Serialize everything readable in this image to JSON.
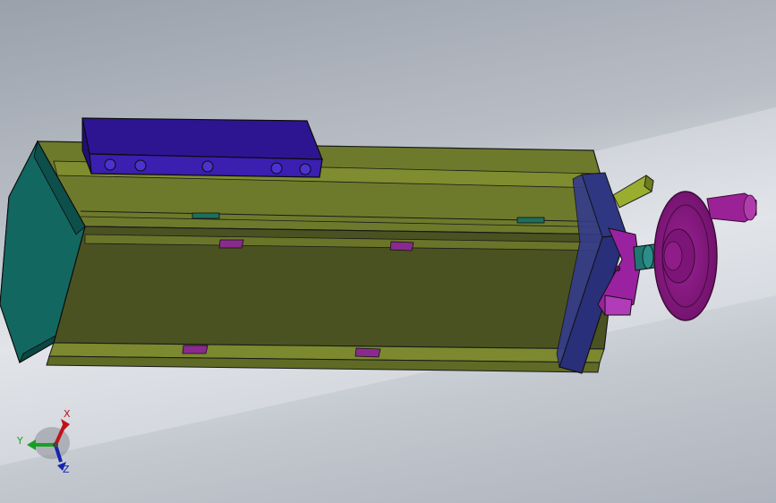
{
  "viewport": {
    "background_top": "#9aa1ab",
    "background_band": "#dfe2e7"
  },
  "model": {
    "body_color": "#4e5427",
    "rail_color": "#7d8a2d",
    "end_cap_color": "#0f5e58",
    "top_bar_color": "#2d1592",
    "plate_color": "#2a2f7a",
    "handwheel_color": "#8a1b85",
    "shaft_color": "#1f7772",
    "bracket_color": "#9a22a0"
  },
  "triad": {
    "x_label": "X",
    "y_label": "Y",
    "z_label": "Z",
    "x_color": "#c0121a",
    "y_color": "#17a023",
    "z_color": "#1525b0"
  }
}
